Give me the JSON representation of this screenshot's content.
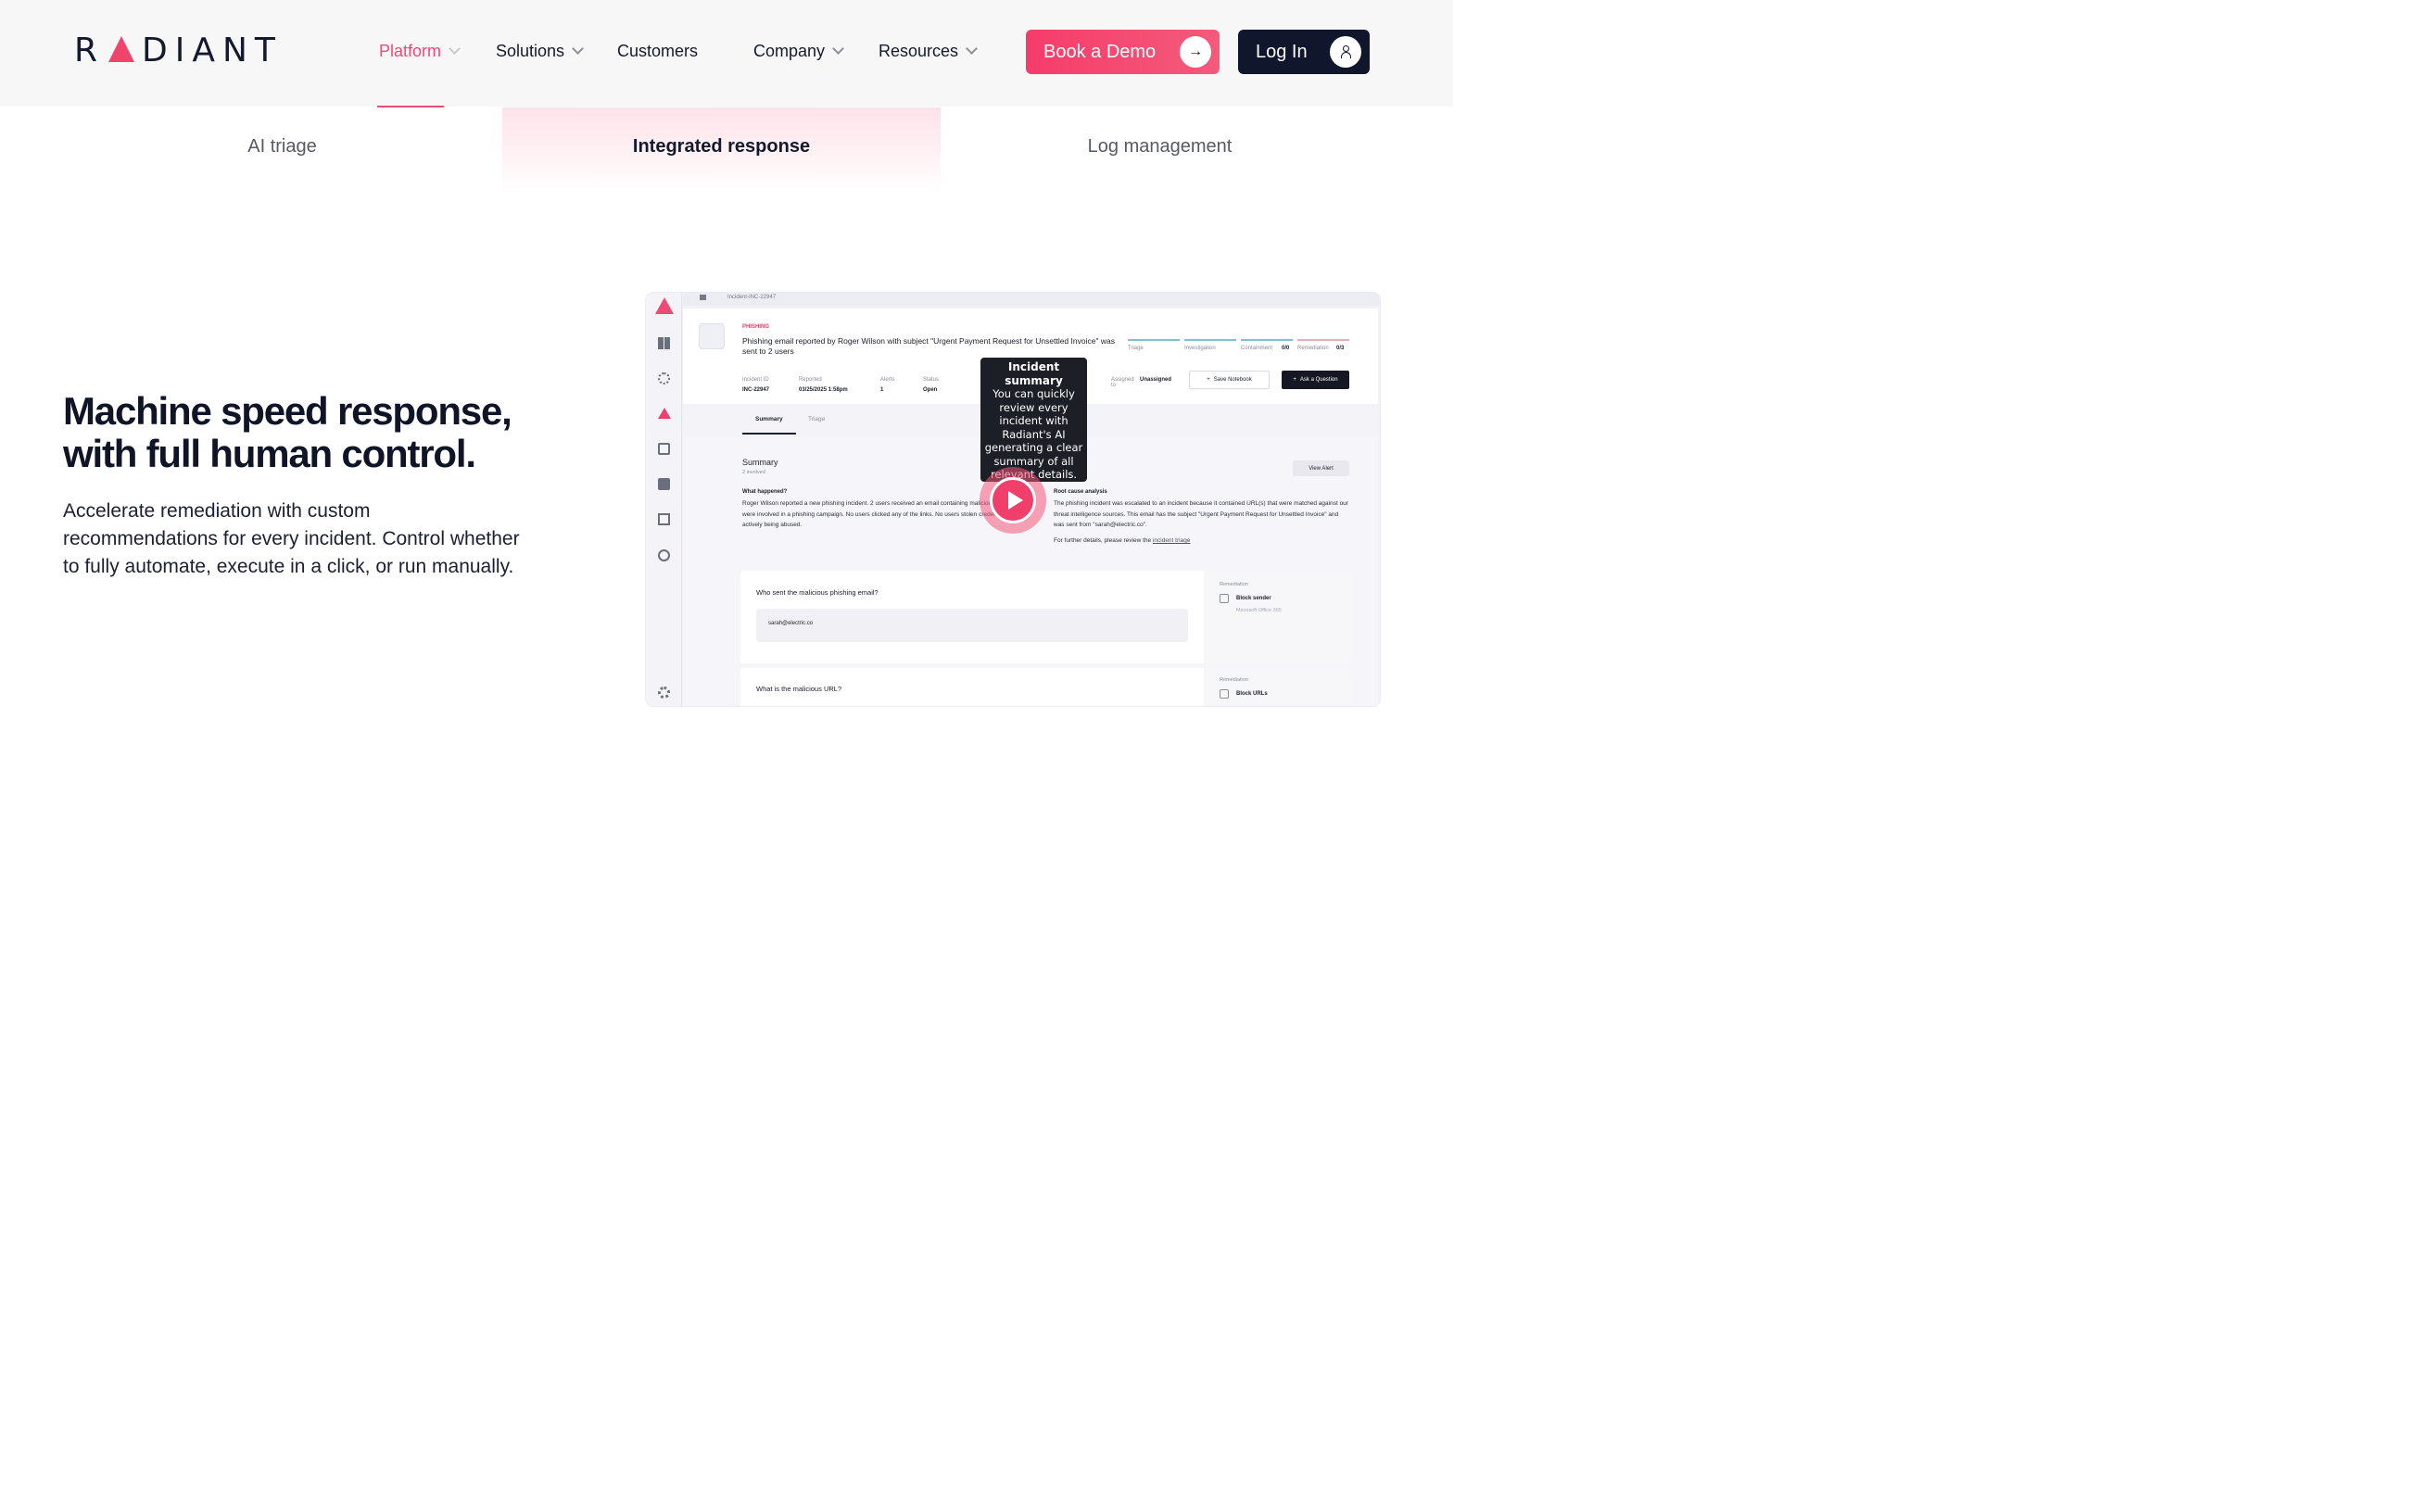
{
  "header": {
    "logo_text": "RADIANT",
    "nav": [
      {
        "label": "Platform",
        "has_dropdown": true,
        "active": true
      },
      {
        "label": "Solutions",
        "has_dropdown": true
      },
      {
        "label": "Customers",
        "has_dropdown": false
      },
      {
        "label": "Company",
        "has_dropdown": true
      },
      {
        "label": "Resources",
        "has_dropdown": true
      }
    ],
    "book_demo_label": "Book a Demo",
    "login_label": "Log In"
  },
  "tabs": [
    {
      "label": "AI triage",
      "active": false
    },
    {
      "label": "Integrated response",
      "active": true
    },
    {
      "label": "Log management",
      "active": false
    }
  ],
  "hero": {
    "title": "Machine speed response, with full human control.",
    "body": "Accelerate remediation with custom recommendations for every incident. Control whether to fully automate, execute in a click, or run manually."
  },
  "screenshot": {
    "breadcrumb": "Incident-INC-22947",
    "category": "PHISHING",
    "incident_title": "Phishing email reported by Roger Wilson with subject \"Urgent Payment Request for Unsettled Invoice\" was sent to 2 users",
    "stages": [
      {
        "label": "Triage",
        "value": ""
      },
      {
        "label": "Investigation",
        "value": ""
      },
      {
        "label": "Containment",
        "value": "0/0"
      },
      {
        "label": "Remediation",
        "value": "0/3"
      }
    ],
    "meta": [
      {
        "label": "Incident ID",
        "value": "INC-22947"
      },
      {
        "label": "Reported",
        "value": "03/25/2025 1:58pm"
      },
      {
        "label": "Alerts",
        "value": "1"
      },
      {
        "label": "Status",
        "value": "Open"
      }
    ],
    "assigned_label": "Assigned to",
    "assigned_value": "Unassigned",
    "save_notebook": "Save Notebook",
    "ask_question": "Ask a Question",
    "inner_tabs": [
      "Summary",
      "Triage"
    ],
    "summary_title": "Summary",
    "summary_sub": "2 involved",
    "view_alert": "View Alert",
    "what_happened_label": "What happened?",
    "what_happened_text": "Roger Wilson reported a new phishing incident. 2 users received an email containing malicious links and were involved in a phishing campaign. No users clicked any of the links. No users stolen credentials are actively being abused.",
    "root_cause_label": "Root cause analysis",
    "root_cause_text": "The phishing incident was escalated to an incident because it contained URL(s) that were matched against our threat intelligence sources. This email has the subject \"Urgent Payment Request for Unsettled Invoice\" and was sent from \"sarah@electric.co\".",
    "further_details_prefix": "For further details, please review the",
    "further_details_link": "incident triage",
    "q1": "Who sent the malicious phishing email?",
    "q1_answer": "sarah@electric.co",
    "q1_remediation_label": "Remediation",
    "q1_remediation_action": "Block sender",
    "q1_remediation_source": "Microsoft Office 365",
    "q2": "What is the malicious URL?",
    "q2_remediation_label": "Remediation",
    "q2_remediation_action": "Block URLs",
    "tooltip_title": "Incident summary",
    "tooltip_body": "You can quickly review every incident with Radiant's AI generating a clear summary of all relevant details."
  },
  "colors": {
    "accent": "#ef4a73",
    "dark": "#10162b",
    "header_bg": "#f7f7f8"
  }
}
